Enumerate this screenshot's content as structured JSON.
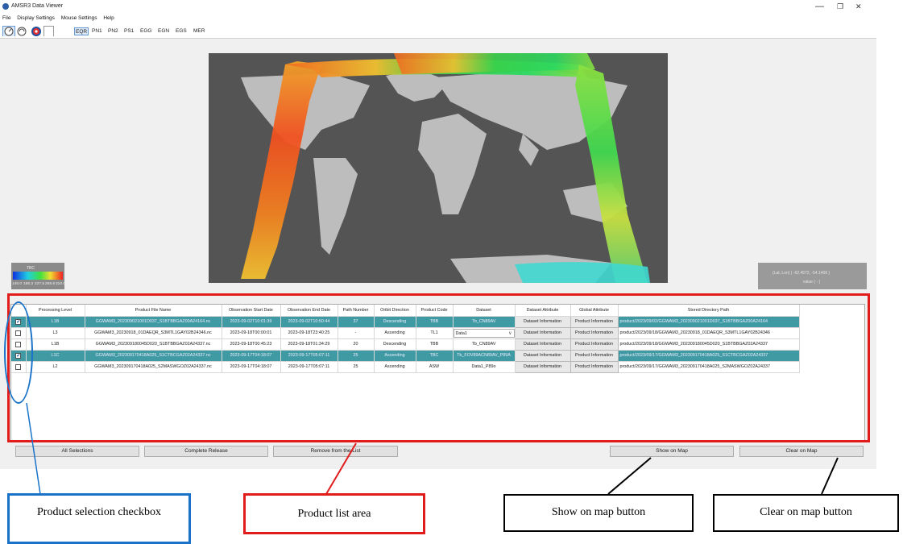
{
  "app": {
    "title": "AMSR3 Data Viewer",
    "window_controls": {
      "minimize": "—",
      "restore": "❐",
      "close": "✕"
    }
  },
  "menu": [
    "File",
    "Display Settings",
    "Mouse Settings",
    "Help"
  ],
  "toolbar": {
    "icons": [
      "zoom-dial-icon",
      "rotate-dial-icon",
      "color-wheel-icon",
      "blank-swatch-icon"
    ],
    "projections": [
      "EQR",
      "PN1",
      "PN2",
      "PS1",
      "EGG",
      "EGN",
      "EGS",
      "MER"
    ],
    "selected_projection": "EQR"
  },
  "map": {
    "colorbar": {
      "label": "TBC",
      "ticks": [
        "145.0",
        "186.3",
        "227.5",
        "268.8",
        "310.0"
      ]
    },
    "coordinate_readout": "(Lat, Lon) ( -62.4572, -54.1406 )",
    "value_readout": "value ( - )"
  },
  "product_list": {
    "columns": [
      "",
      "Processing Level",
      "Product File Name",
      "Observation Start Date",
      "Observation End Date",
      "Path Number",
      "Oribit Direction",
      "Product Code",
      "Dataset",
      "Dataset Attribute",
      "Global Attribute",
      "Stored Directory Path"
    ],
    "rows": [
      {
        "checked": true,
        "highlight": true,
        "level": "L1B",
        "file": "GGWAM3_202309021001D037_S1BTBBGAZ00A24164.nc",
        "start": "2023-09-02T10:01:39",
        "end": "2023-09-02T10:50:44",
        "path": "37",
        "direction": "Descending",
        "code": "TBB",
        "dataset": "Tb_CN89AV",
        "dataset_is_dropdown": false,
        "dataset_attr": "Dataset Information",
        "global_attr": "Product Information",
        "dir": "product/2023/09/02/GGWAM3_202309021001D037_S1BTBBGAZ00A24164"
      },
      {
        "checked": false,
        "highlight": false,
        "level": "L3",
        "file": "GGWAM3_20230918_01DAEQR_S3MTL1GAY02B24346.nc",
        "start": "2023-09-18T00:00:01",
        "end": "2023-09-18T23:40:25",
        "path": "-",
        "direction": "Ascending",
        "code": "TL1",
        "dataset": "Data1",
        "dataset_is_dropdown": true,
        "dataset_attr": "Dataset Information",
        "global_attr": "Product Information",
        "dir": "product/2023/09/18/GGWAM3_20230918_01DAEQR_S3MTL1GAY02B24346"
      },
      {
        "checked": false,
        "highlight": false,
        "level": "L1B",
        "file": "GGWAM3_202309180045D020_S1BTBBGAZ02A24337.nc",
        "start": "2023-09-18T00:45:23",
        "end": "2023-09-18T01:34:29",
        "path": "20",
        "direction": "Descending",
        "code": "TBB",
        "dataset": "Tb_CN89AV",
        "dataset_is_dropdown": false,
        "dataset_attr": "Dataset Information",
        "global_attr": "Product Information",
        "dir": "product/2023/09/18/GGWAM3_202309180045D020_S1BTBBGAZ02A24337"
      },
      {
        "checked": true,
        "highlight": true,
        "level": "L1C",
        "file": "GGWAM3_202309170418A025_S1CTBCGAZ02A24337.nc",
        "start": "2023-09-17T04:18:07",
        "end": "2023-09-17T05:07:11",
        "path": "25",
        "direction": "Ascending",
        "code": "TBC",
        "dataset": "Tb_FOV89ACN89AV_P89A",
        "dataset_is_dropdown": false,
        "dataset_attr": "Dataset Information",
        "global_attr": "Product Information",
        "dir": "product/2023/09/17/GGWAM3_202309170418A025_S1CTBCGAZ02A24337"
      },
      {
        "checked": false,
        "highlight": false,
        "level": "L2",
        "file": "GGWAM3_202309170418A025_S2MASWGOZ02A24337.nc",
        "start": "2023-09-17T04:18:07",
        "end": "2023-09-17T05:07:11",
        "path": "25",
        "direction": "Ascending",
        "code": "ASW",
        "dataset": "Data1_P89o",
        "dataset_is_dropdown": false,
        "dataset_attr": "Dataset Information",
        "global_attr": "Product Information",
        "dir": "product/2023/09/17/GGWAM3_202309170418A025_S2MASWGOZ02A24337"
      }
    ]
  },
  "buttons": {
    "all_selections": "All Selections",
    "complete_release": "Complete Release",
    "remove": "Remove from the List",
    "show_on_map": "Show on Map",
    "clear_on_map": "Clear on Map"
  },
  "callouts": {
    "checkbox": "Product selection checkbox",
    "list_area": "Product list area",
    "show_button": "Show on map button",
    "clear_button": "Clear on map button"
  },
  "colors": {
    "highlight_row": "#3f9aa3",
    "product_list_frame": "#e21b1b",
    "checkbox_callout": "#1a73c9",
    "map_ocean": "#545454"
  }
}
